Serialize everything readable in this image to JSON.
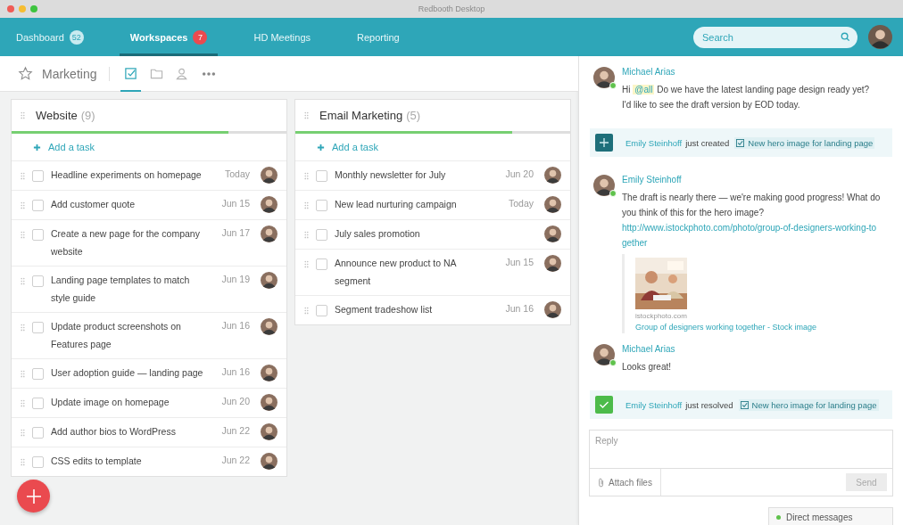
{
  "window": {
    "title": "Redbooth Desktop"
  },
  "nav": {
    "tabs": [
      {
        "label": "Dashboard",
        "badge": "52",
        "alert": false,
        "selected": false
      },
      {
        "label": "Workspaces",
        "badge": "7",
        "alert": true,
        "selected": true
      },
      {
        "label": "HD Meetings",
        "selected": false
      },
      {
        "label": "Reporting",
        "selected": false
      }
    ],
    "search": {
      "placeholder": "Search"
    }
  },
  "workspace": {
    "title": "Marketing",
    "starred": false,
    "views": [
      {
        "kind": "tasks",
        "selected": true
      },
      {
        "kind": "files",
        "selected": false
      },
      {
        "kind": "people",
        "selected": false
      }
    ]
  },
  "task_lists": [
    {
      "title": "Website",
      "count": "(9)",
      "level": 0.79,
      "add_label": "Add a task",
      "tasks": [
        {
          "title": "Headline experiments on homepage",
          "due": "Today",
          "checked": false
        },
        {
          "title": "Add customer quote",
          "due": "Jun 15",
          "checked": false
        },
        {
          "title": "Create a new page for the company website",
          "due": "Jun 17",
          "checked": false
        },
        {
          "title": "Landing page templates to match style guide",
          "due": "Jun 19",
          "checked": false
        },
        {
          "title": "Update product screenshots on Features page",
          "due": "Jun 16",
          "checked": false
        },
        {
          "title": "User adoption guide — landing page",
          "due": "Jun 16",
          "checked": false
        },
        {
          "title": "Update image on homepage",
          "due": "Jun 20",
          "checked": false
        },
        {
          "title": "Add author bios to WordPress",
          "due": "Jun 22",
          "checked": false
        },
        {
          "title": "CSS edits to template",
          "due": "Jun 22",
          "checked": false
        }
      ]
    },
    {
      "title": "Email Marketing",
      "count": "(5)",
      "level": 0.79,
      "add_label": "Add a task",
      "tasks": [
        {
          "title": "Monthly newsletter for July",
          "due": "Jun 20",
          "checked": false
        },
        {
          "title": "New lead nurturing campaign",
          "due": "Today",
          "checked": false
        },
        {
          "title": "July sales promotion",
          "checked": false
        },
        {
          "title": "Announce new product to NA segment",
          "due": "Jun 15",
          "checked": false
        },
        {
          "title": "Segment tradeshow list",
          "due": "Jun 16",
          "checked": false
        }
      ]
    }
  ],
  "conversation": [
    {
      "kind": "message",
      "author": "Michael Arias",
      "online": true,
      "prefix": "Hi",
      "mention": "@all",
      "lines": [
        "Do we have the latest landing page design ready yet?",
        "I'd like to see the draft version by EOD today."
      ]
    },
    {
      "kind": "activity_created",
      "actor": "Emily Steinhoff",
      "verb": "just created",
      "task": "New hero image for landing page"
    },
    {
      "kind": "message",
      "author": "Emily Steinhoff",
      "online": true,
      "lines": [
        "The draft is nearly there — we're making good progress! What do you think of this for the hero image?"
      ],
      "link": "http://www.istockphoto.com/photo/group-of-designers-working-together",
      "preview": {
        "kind": "picture",
        "source": "istockphoto.com",
        "title": "Group of designers working together - Stock image"
      }
    },
    {
      "kind": "message",
      "author": "Michael Arias",
      "online": true,
      "lines": [
        "Looks great!"
      ]
    },
    {
      "kind": "activity_resolved",
      "actor": "Emily Steinhoff",
      "verb": "just resolved",
      "task": "New hero image for landing page"
    }
  ],
  "reply": {
    "placeholder": "Reply",
    "attach_label": "Attach files",
    "send_label": "Send",
    "send_disabled": true
  },
  "direct_messages": {
    "label": "Direct messages",
    "online": true
  }
}
